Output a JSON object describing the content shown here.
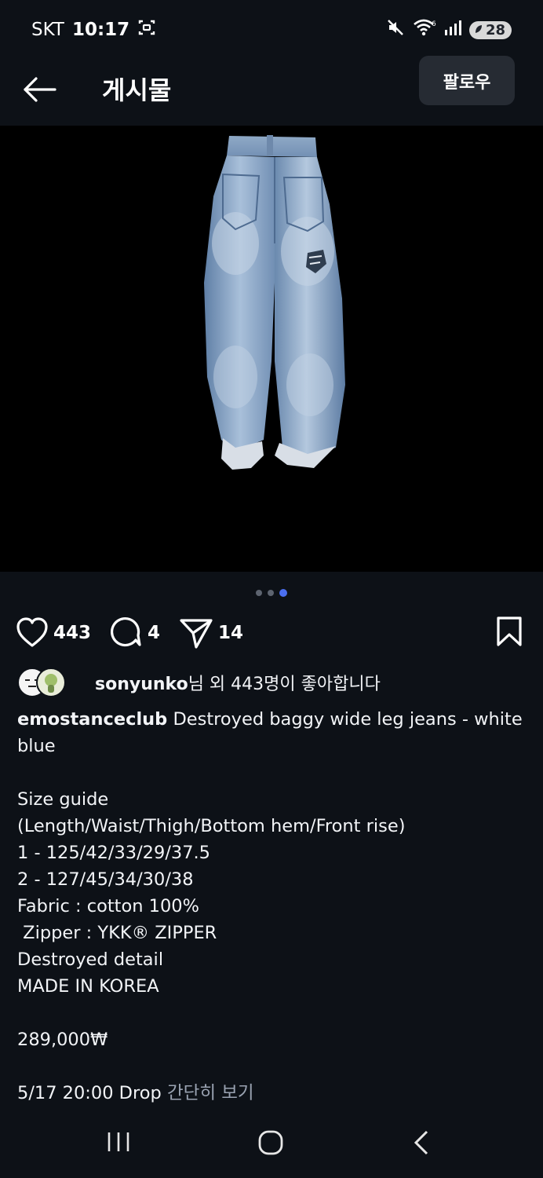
{
  "status_bar": {
    "carrier": "SKT",
    "time": "10:17",
    "battery": "28"
  },
  "header": {
    "title": "게시물",
    "follow_label": "팔로우"
  },
  "carousel": {
    "total": 3,
    "active_index": 3
  },
  "actions": {
    "likes": "443",
    "comments": "4",
    "shares": "14"
  },
  "liked_by": {
    "user": "sonyunko",
    "suffix": "님 외 443명이 좋아합니다"
  },
  "caption": {
    "username": "emostanceclub",
    "title": " Destroyed baggy wide leg jeans - white blue",
    "body": "Size guide\n(Length/Waist/Thigh/Bottom hem/Front rise)\n1 - 125/42/33/29/37.5\n2 - 127/45/34/30/38\nFabric : cotton 100%\n Zipper : YKK® ZIPPER\nDestroyed detail\nMADE IN KOREA\n\n289,000₩\n\n5/17 20:00 Drop ",
    "more_label": "간단히 보기"
  },
  "colors": {
    "background": "#0d1117",
    "accent_dot": "#4b6ff0",
    "denim": "#8eaacb"
  }
}
